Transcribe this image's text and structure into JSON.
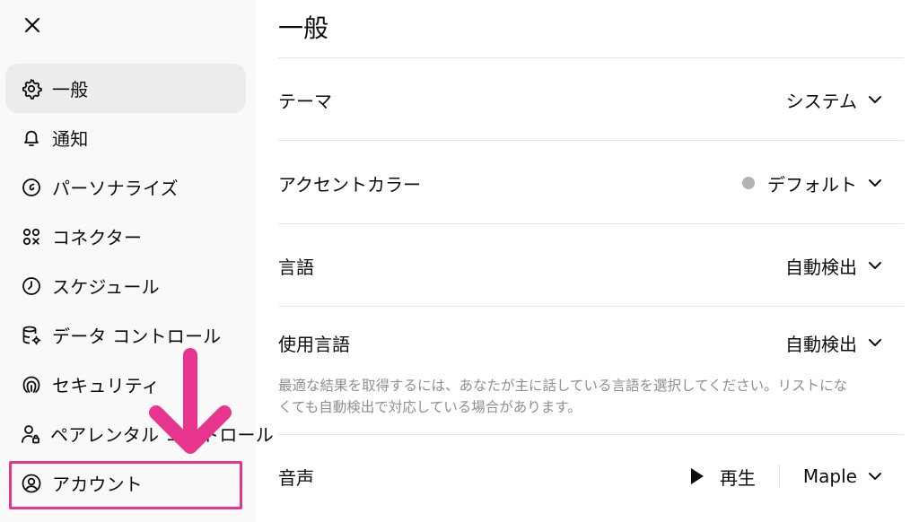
{
  "sidebar": {
    "close_icon": "close-icon",
    "items": [
      {
        "label": "一般",
        "icon": "gear-icon",
        "active": true
      },
      {
        "label": "通知",
        "icon": "bell-icon"
      },
      {
        "label": "パーソナライズ",
        "icon": "personalize-icon"
      },
      {
        "label": "コネクター",
        "icon": "connectors-icon"
      },
      {
        "label": "スケジュール",
        "icon": "clock-icon"
      },
      {
        "label": "データ コントロール",
        "icon": "database-icon"
      },
      {
        "label": "セキュリティ",
        "icon": "security-icon"
      },
      {
        "label": "ペアレンタル コントロール",
        "icon": "parental-icon"
      },
      {
        "label": "アカウント",
        "icon": "account-icon",
        "highlighted": true
      }
    ]
  },
  "main": {
    "title": "一般",
    "rows": {
      "theme": {
        "label": "テーマ",
        "value": "システム"
      },
      "accent": {
        "label": "アクセントカラー",
        "value": "デフォルト",
        "dot_color": "#b4b4b4"
      },
      "language": {
        "label": "言語",
        "value": "自動検出"
      },
      "spoken_language": {
        "label": "使用言語",
        "value": "自動検出"
      },
      "spoken_language_desc": "最適な結果を取得するには、あなたが主に話している言語を選択してください。リストになくても自動検出で対応している場合があります。",
      "voice": {
        "label": "音声",
        "play_label": "再生",
        "value": "Maple"
      }
    }
  },
  "colors": {
    "highlight": "#e8368f",
    "sidebar_bg": "#f9f9f9",
    "active_bg": "#ececec"
  }
}
